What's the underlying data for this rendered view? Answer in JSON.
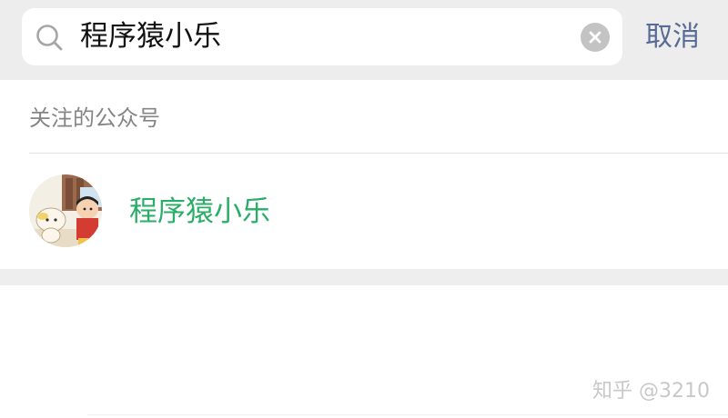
{
  "search": {
    "query": "程序猿小乐",
    "cancel_label": "取消"
  },
  "section": {
    "header": "关注的公众号"
  },
  "results": [
    {
      "name": "程序猿小乐",
      "avatar": "cartoon-avatar"
    }
  ],
  "watermark": "知乎 @3210",
  "colors": {
    "accent_green": "#2aae67",
    "link_blue": "#576b95",
    "search_bg": "#ededed"
  },
  "icons": {
    "search": "search-icon",
    "clear": "clear-icon"
  }
}
